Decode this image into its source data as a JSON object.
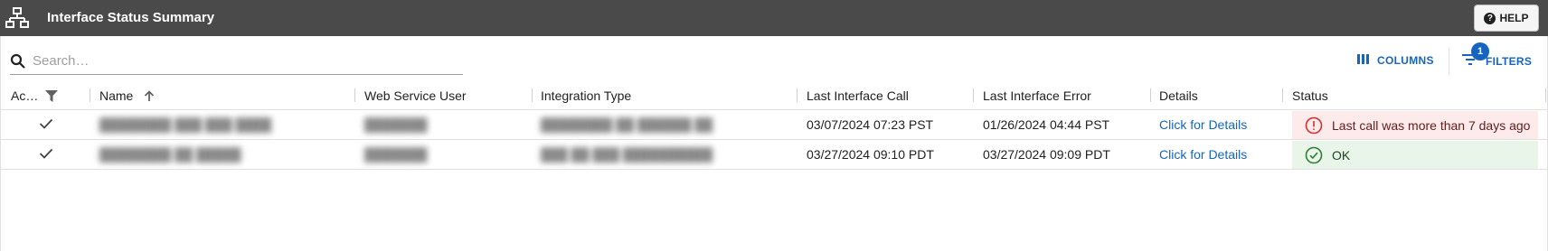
{
  "header": {
    "title": "Interface Status Summary",
    "help_label": "HELP"
  },
  "search": {
    "placeholder": "Search…",
    "value": ""
  },
  "toolbar": {
    "columns_label": "COLUMNS",
    "filters_label": "FILTERS",
    "filters_count": "1"
  },
  "table": {
    "headers": {
      "active": "Ac…",
      "name": "Name",
      "web_service_user": "Web Service User",
      "integration_type": "Integration Type",
      "last_interface_call": "Last Interface Call",
      "last_interface_error": "Last Interface Error",
      "details": "Details",
      "status": "Status"
    },
    "rows": [
      {
        "active": "✓",
        "name": "████████ ███ ███ ████",
        "web_service_user": "███████",
        "integration_type": "████████ ██ ██████ ██",
        "last_interface_call": "03/07/2024 07:23 PST",
        "last_interface_error": "01/26/2024 04:44 PST",
        "details": "Click for Details",
        "status": "Last call was more than 7 days ago",
        "status_kind": "warning"
      },
      {
        "active": "✓",
        "name": "████████ ██ █████",
        "web_service_user": "███████",
        "integration_type": "███ ██ ███ ██████████",
        "last_interface_call": "03/27/2024 09:10 PDT",
        "last_interface_error": "03/27/2024 09:09 PDT",
        "details": "Click for Details",
        "status": "OK",
        "status_kind": "ok"
      }
    ]
  },
  "colors": {
    "header_bg": "#4a4a4a",
    "accent": "#1565c0",
    "warning_bg": "#fdeaea",
    "warning_icon": "#d32f2f",
    "ok_bg": "#e9f5e9",
    "ok_icon": "#2e7d32"
  },
  "icons": {
    "app": "network-icon",
    "help": "help-circle-icon",
    "search": "search-icon",
    "columns": "columns-icon",
    "filters": "filter-list-icon",
    "filter_header": "filter-icon",
    "sort": "arrow-up-icon",
    "check": "check-icon",
    "warning": "error-outline-icon",
    "ok": "check-circle-icon"
  }
}
